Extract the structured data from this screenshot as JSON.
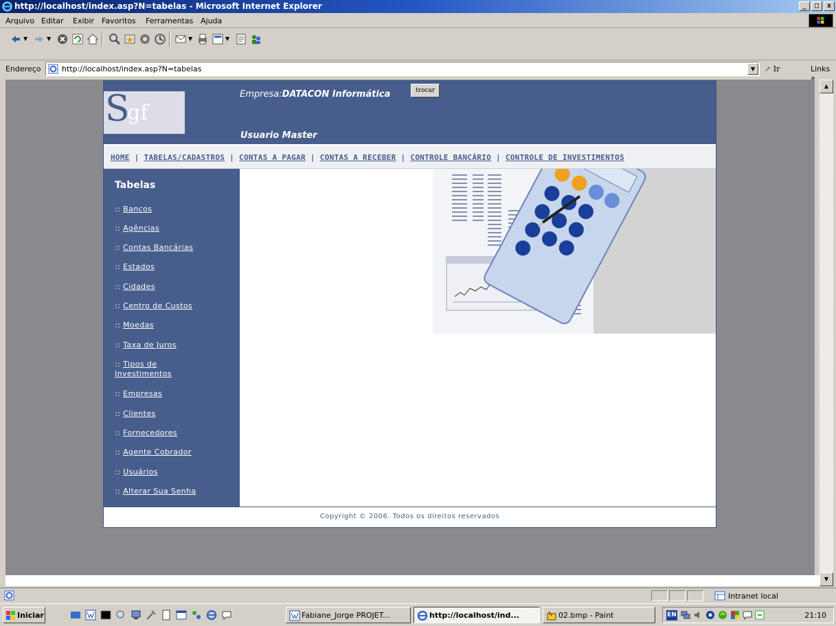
{
  "window": {
    "title": "http://localhost/index.asp?N=tabelas - Microsoft Internet Explorer",
    "controls": [
      "_",
      "□",
      "x"
    ]
  },
  "menubar": {
    "items": [
      "Arquivo",
      "Editar",
      "Exibir",
      "Favoritos",
      "Ferramentas",
      "Ajuda"
    ]
  },
  "toolbar": {
    "icons": [
      "back-icon",
      "forward-icon",
      "stop-icon",
      "refresh-icon",
      "home-icon",
      "search-icon",
      "favorites-icon",
      "media-icon",
      "history-icon",
      "mail-icon",
      "print-icon",
      "edit-icon",
      "discuss-icon",
      "messenger-icon"
    ]
  },
  "addressbar": {
    "label": "Endereço",
    "url": "http://localhost/index.asp?N=tabelas",
    "go_label": "Ir",
    "links_label": "Links »"
  },
  "page": {
    "logo_first": "S",
    "logo_rest": "gf",
    "empresa_prefix": "Empresa:",
    "empresa_name": "DATACON Informática",
    "trocar_label": "trocar",
    "usuario": "Usuario Master",
    "nav": [
      "HOME",
      "TABELAS/CADASTROS",
      "CONTAS A PAGAR",
      "CONTAS A RECEBER",
      "CONTROLE BANCÁRIO",
      "CONTROLE DE INVESTIMENTOS"
    ],
    "nav_sep": "|",
    "sidebar_heading": "Tabelas",
    "sidebar_prefix": "::",
    "sidebar_items": [
      "Bancos",
      "Agências",
      "Contas Bancárias",
      "Estados",
      "Cidades",
      "Centro de Custos",
      "Moedas",
      "Taxa de Juros",
      "Tipos de Investimentos",
      "Empresas",
      "Clientes",
      "Fornecedores",
      "Agente Cobrador",
      "Usuários",
      "Alterar Sua Senha"
    ],
    "copyright": "Copyright © 2006. Todos os direitos reservados"
  },
  "statusbar": {
    "zone": "Intranet local"
  },
  "taskbar": {
    "start_label": "Iniciar",
    "tasks": [
      "Fabiane_Jorge PROJET...",
      "http://localhost/ind...",
      "02.bmp - Paint"
    ],
    "tray_lang": "EN",
    "clock": "21:10"
  },
  "colors": {
    "brand": "#475d8c",
    "titlebar_start": "#0a246a",
    "titlebar_end": "#a6caf0",
    "chrome": "#d4d0c8"
  }
}
